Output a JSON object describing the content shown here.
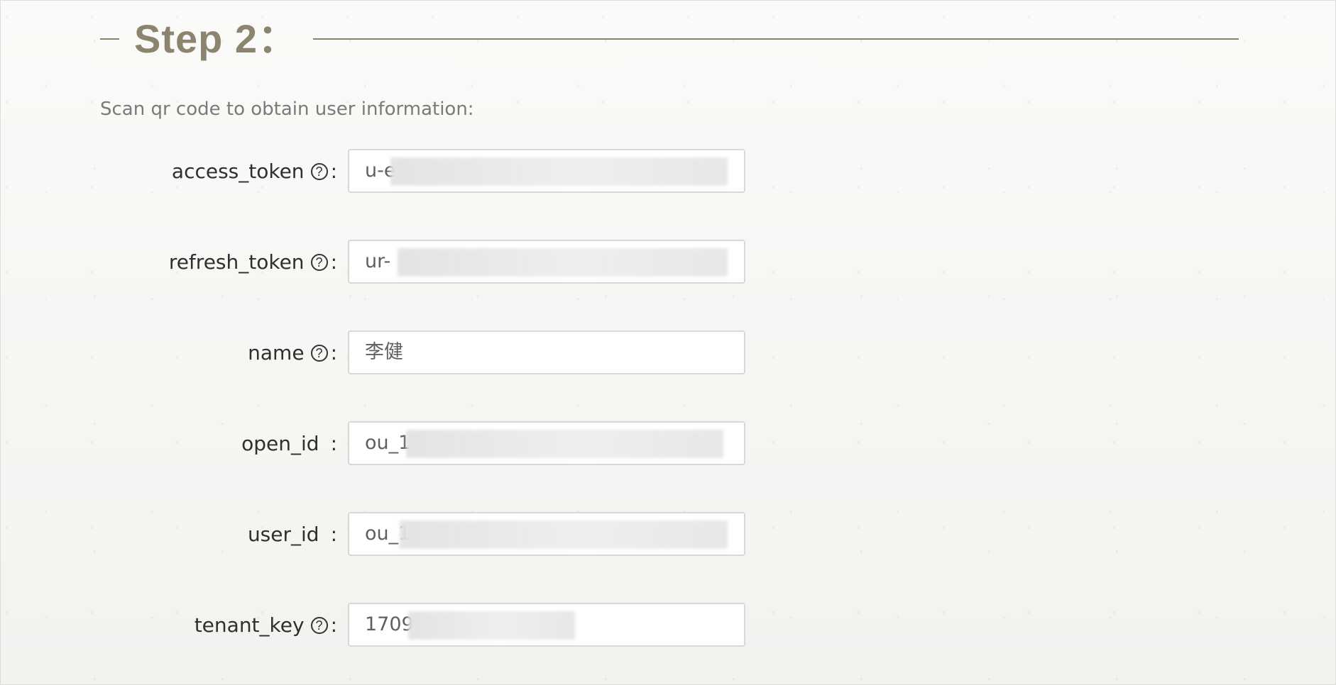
{
  "step": {
    "title": "Step 2："
  },
  "intro": "Scan qr code to obtain user information:",
  "fields": [
    {
      "label": "access_token",
      "help_icon": "help-circle-icon",
      "colon": ":",
      "value": "u-e"
    },
    {
      "label": "refresh_token",
      "help_icon": "help-circle-icon",
      "colon": ":",
      "value": "ur-"
    },
    {
      "label": "name",
      "help_icon": "help-circle-icon",
      "colon": ":",
      "value": "李健"
    },
    {
      "label": "open_id",
      "colon": ":",
      "value": "ou_1"
    },
    {
      "label": "user_id",
      "colon": ":",
      "value": "ou_1"
    },
    {
      "label": "tenant_key",
      "help_icon": "help-circle-icon",
      "colon": ":",
      "value": "1709"
    }
  ],
  "colors": {
    "accent": "#8d8470",
    "text": "#2f2f2f",
    "muted": "#7a7a7a",
    "border": "#d8d8d8"
  }
}
